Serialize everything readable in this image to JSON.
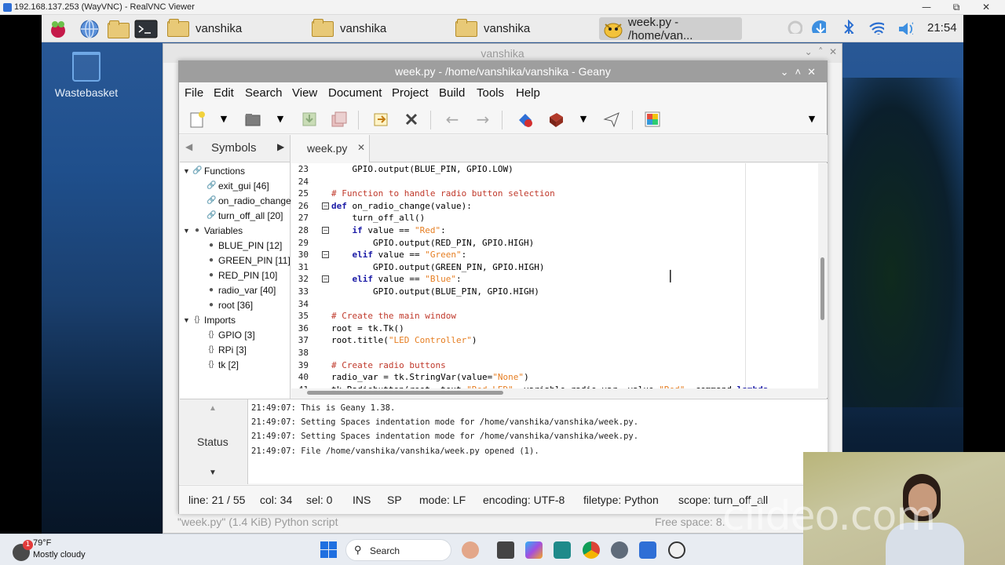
{
  "vnc": {
    "title": "192.168.137.253 (WayVNC) - RealVNC Viewer",
    "minimize": "—",
    "restore": "⧉",
    "close": "✕"
  },
  "pi_taskbar": {
    "buttons": [
      "vanshika",
      "vanshika",
      "vanshika",
      "week.py - /home/van..."
    ],
    "clock": "21:54"
  },
  "desktop": {
    "wastebasket_label": "Wastebasket"
  },
  "file_manager": {
    "title": "vanshika",
    "status_left": "\"week.py\" (1.4 KiB) Python script",
    "status_right": "Free space: 8."
  },
  "geany": {
    "title": "week.py - /home/vanshika/vanshika - Geany",
    "menu": [
      "File",
      "Edit",
      "Search",
      "View",
      "Document",
      "Project",
      "Build",
      "Tools",
      "Help"
    ],
    "sidebar_tab": "Symbols",
    "symbols": {
      "functions": {
        "label": "Functions",
        "items": [
          "exit_gui [46]",
          "on_radio_change",
          "turn_off_all [20]"
        ]
      },
      "variables": {
        "label": "Variables",
        "items": [
          "BLUE_PIN [12]",
          "GREEN_PIN [11]",
          "RED_PIN [10]",
          "radio_var [40]",
          "root [36]"
        ]
      },
      "imports": {
        "label": "Imports",
        "items": [
          "GPIO [3]",
          "RPi [3]",
          "tk [2]"
        ]
      }
    },
    "file_tab": "week.py",
    "line_numbers": [
      "23",
      "24",
      "25",
      "26",
      "27",
      "28",
      "29",
      "30",
      "31",
      "32",
      "33",
      "34",
      "35",
      "36",
      "37",
      "38",
      "39",
      "40",
      "41"
    ],
    "messages_tab": "Status",
    "messages": [
      "21:49:07: This is Geany 1.38.",
      "21:49:07: Setting Spaces indentation mode for /home/vanshika/vanshika/week.py.",
      "21:49:07: Setting Spaces indentation mode for /home/vanshika/vanshika/week.py.",
      "21:49:07: File /home/vanshika/vanshika/week.py opened (1)."
    ],
    "status": {
      "line": "line: 21 / 55",
      "col": "col: 34",
      "sel": "sel: 0",
      "mode_ins": "INS",
      "mode_sp": "SP",
      "eol": "mode: LF",
      "encoding": "encoding: UTF-8",
      "filetype": "filetype: Python",
      "scope": "scope: turn_off_all"
    }
  },
  "windows": {
    "weather_temp": "79°F",
    "weather_cond": "Mostly cloudy",
    "weather_badge": "1",
    "search_label": "Search"
  },
  "watermark": "clideo.com",
  "colors": {
    "comment": "#c0392b",
    "keyword": "#1a1aa6",
    "string": "#e67e22",
    "geany_titlebar": "#9e9e9e"
  }
}
